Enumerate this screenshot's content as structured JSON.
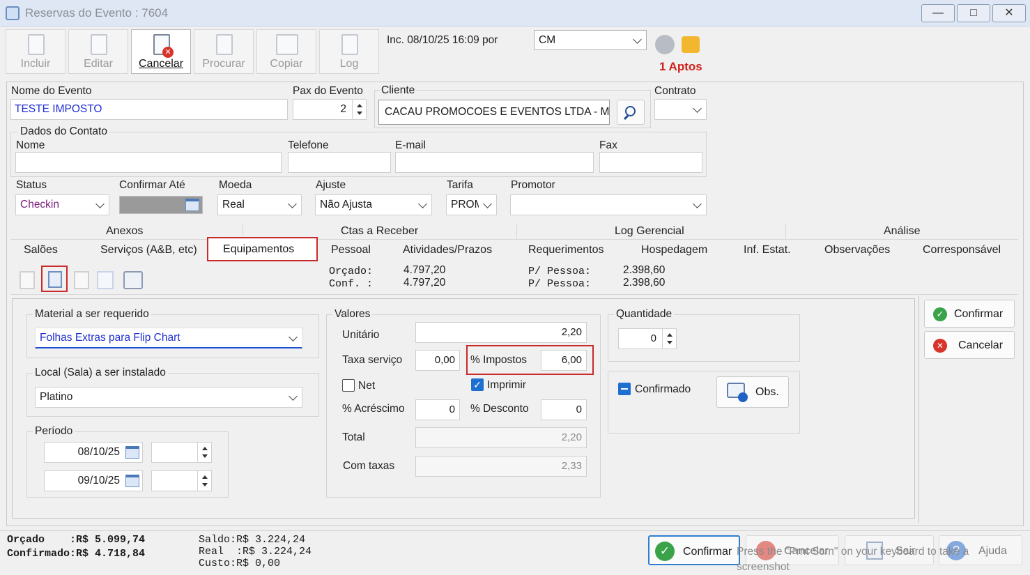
{
  "window": {
    "title": "Reservas do Evento : 7604"
  },
  "toolbar": {
    "incluir": "Incluir",
    "editar": "Editar",
    "cancelar": "Cancelar",
    "procurar": "Procurar",
    "copiar": "Copiar",
    "log": "Log",
    "inc_info": "Inc. 08/10/25 16:09 por",
    "user": "CM",
    "aptos": "1 Aptos"
  },
  "evento": {
    "nome_label": "Nome do Evento",
    "nome_value": "TESTE IMPOSTO",
    "pax_label": "Pax do Evento",
    "pax_value": "2",
    "cliente_label": "Cliente",
    "cliente_value": "CACAU PROMOCOES E EVENTOS LTDA - M",
    "contrato_label": "Contrato"
  },
  "contato": {
    "group_label": "Dados do Contato",
    "nome_label": "Nome",
    "telefone_label": "Telefone",
    "email_label": "E-mail",
    "fax_label": "Fax"
  },
  "status_row": {
    "status_label": "Status",
    "status_value": "Checkin",
    "confirmar_label": "Confirmar Até",
    "moeda_label": "Moeda",
    "moeda_value": "Real",
    "ajuste_label": "Ajuste",
    "ajuste_value": "Não Ajusta",
    "tarifa_label": "Tarifa",
    "tarifa_value": "PROM",
    "promotor_label": "Promotor"
  },
  "tabs_top": [
    "Anexos",
    "Ctas a Receber",
    "Log Gerencial",
    "Análise"
  ],
  "tabs_bottom": [
    "Salões",
    "Serviços (A&B, etc)",
    "Equipamentos",
    "Pessoal",
    "Atividades/Prazos",
    "Requerimentos",
    "Hospedagem",
    "Inf. Estat.",
    "Observações",
    "Corresponsável"
  ],
  "summary": {
    "orcado_label": "Orçado:",
    "orcado_value": "4.797,20",
    "conf_label": "Conf. :",
    "conf_value": "4.797,20",
    "ppessoa_label": "P/ Pessoa:",
    "ppessoa1": "2.398,60",
    "ppessoa2": "2.398,60"
  },
  "material": {
    "label": "Material a ser requerido",
    "value": "Folhas Extras para Flip Chart"
  },
  "local": {
    "label": "Local (Sala) a ser instalado",
    "value": "Platino"
  },
  "periodo": {
    "label": "Período",
    "inicio": "08/10/25",
    "fim": "09/10/25"
  },
  "valores": {
    "label": "Valores",
    "unitario_label": "Unitário",
    "unitario_value": "2,20",
    "taxa_label": "Taxa serviço",
    "taxa_value": "0,00",
    "impostos_label": "% Impostos",
    "impostos_value": "6,00",
    "net_label": "Net",
    "imprimir_label": "Imprimir",
    "acrescimo_label": "% Acréscimo",
    "acrescimo_value": "0",
    "desconto_label": "% Desconto",
    "desconto_value": "0",
    "total_label": "Total",
    "total_value": "2,20",
    "comtaxas_label": "Com taxas",
    "comtaxas_value": "2,33"
  },
  "quantidade": {
    "label": "Quantidade",
    "value": "0"
  },
  "confirmado": {
    "label": "Confirmado",
    "obs": "Obs."
  },
  "side_buttons": {
    "confirmar": "Confirmar",
    "cancelar": "Cancelar"
  },
  "footer": {
    "line1": "Orçado    :R$ 5.099,74",
    "line2": "Confirmado:R$ 4.718,84",
    "saldo": "Saldo:R$ 3.224,24",
    "real": "Real  :R$ 3.224,24",
    "custo": "Custo:R$ 0,00",
    "confirmar": "Confirmar",
    "cancelar": "Cancelar",
    "sair": "Sair",
    "ajuda": "Ajuda",
    "overlay": "Press the \"Prnt Scrn\" on your keyboard to take a screenshot"
  },
  "colors": {
    "accent_blue": "#1f4fd1",
    "red": "#c92a2a",
    "status_purple": "#7a1f7a"
  }
}
